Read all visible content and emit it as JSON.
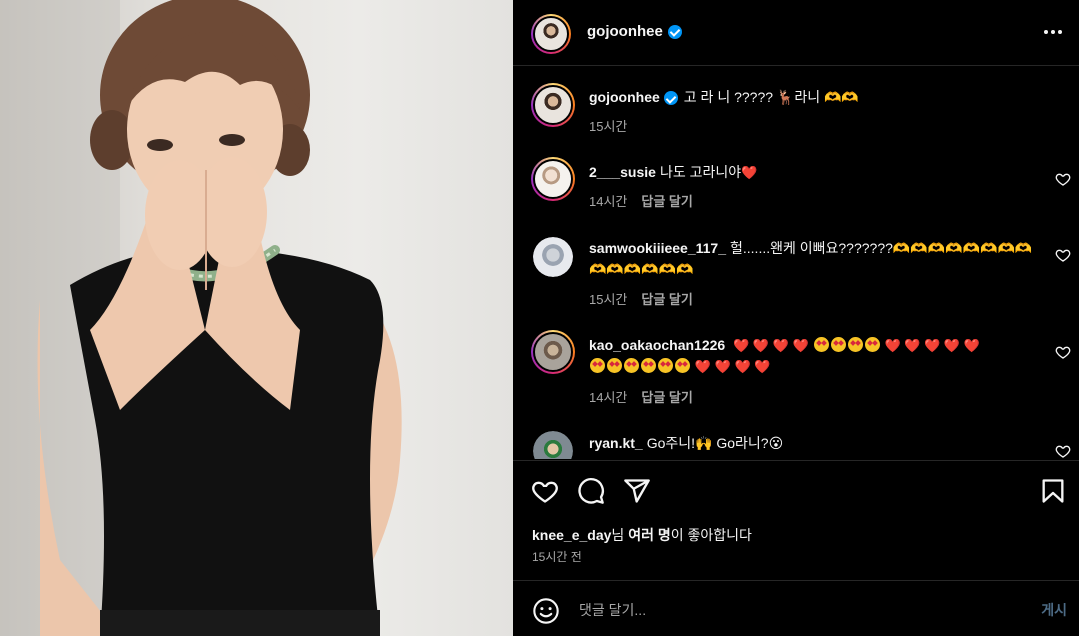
{
  "post": {
    "author": "gojoonhee",
    "photo_alt": "Woman in black sleeveless top covering her mouth with both hands"
  },
  "header": {
    "username": "gojoonhee",
    "more_icon": "more-horizontal-icon"
  },
  "caption": {
    "username": "gojoonhee",
    "text": "고 라 니 ????? 🦌라니 🫶🫶",
    "time": "15시간"
  },
  "comments": [
    {
      "username": "2___susie",
      "text": "나도 고라니야",
      "trail": "❤️",
      "time": "14시간",
      "reply": "답글 달기"
    },
    {
      "username": "samwookiiieee_117_",
      "text": "헐.......왠케 이뻐요???????🫶🫶🫶🫶🫶🫶🫶🫶🫶🫶🫶🫶🫶🫶",
      "time": "15시간",
      "reply": "답글 달기"
    },
    {
      "username": "kao_oakaochan1226",
      "text": "",
      "time": "14시간",
      "reply": "답글 달기"
    },
    {
      "username": "ryan.kt_",
      "text": "Go주니!🙌 Go라니?😮",
      "time": "",
      "reply": ""
    }
  ],
  "likes": {
    "first_user": "knee_e_day",
    "suffix1": "님 ",
    "others": "여러 명",
    "suffix2": "이 좋아합니다"
  },
  "posted_time": "15시간 전",
  "composer": {
    "placeholder": "댓글 달기...",
    "post_label": "게시"
  },
  "colors": {
    "background": "#000000",
    "text": "#f5f5f5",
    "muted": "#a8a8a8",
    "verified": "#0095f6",
    "heart": "#ed2943",
    "post_disabled": "#4d6b85"
  }
}
